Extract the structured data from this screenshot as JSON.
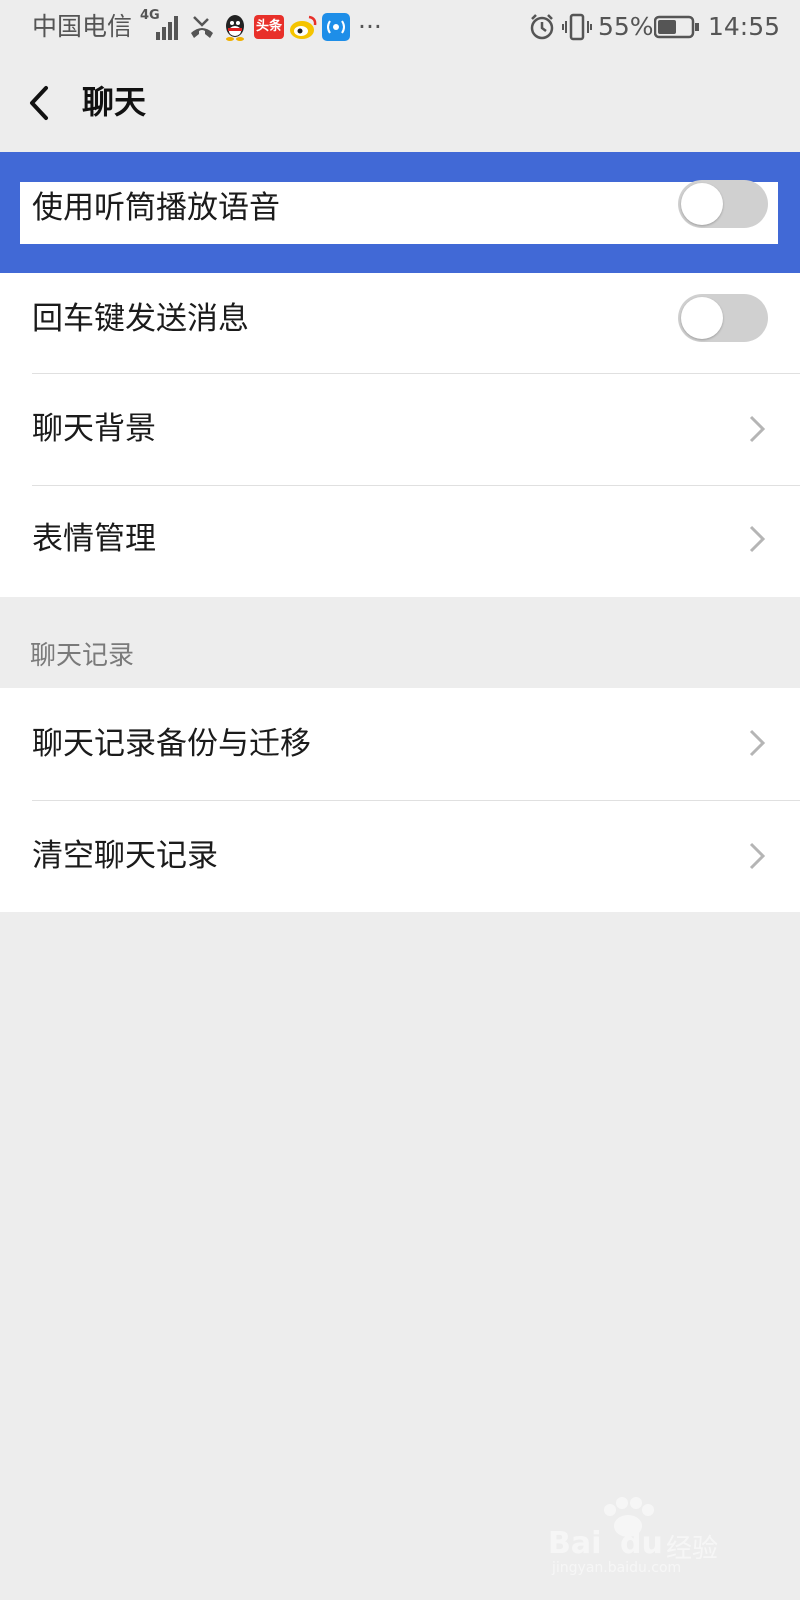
{
  "status_bar": {
    "carrier": "中国电信",
    "network": "4G",
    "battery": "55%",
    "time": "14:55",
    "more": "···",
    "toutiao_label": "头条"
  },
  "nav": {
    "title": "聊天"
  },
  "settings": {
    "general": [
      {
        "label": "使用听筒播放语音",
        "type": "toggle",
        "on": false
      },
      {
        "label": "回车键发送消息",
        "type": "toggle",
        "on": false
      },
      {
        "label": "聊天背景",
        "type": "link"
      },
      {
        "label": "表情管理",
        "type": "link"
      }
    ],
    "history_header": "聊天记录",
    "history": [
      {
        "label": "聊天记录备份与迁移",
        "type": "link"
      },
      {
        "label": "清空聊天记录",
        "type": "link"
      }
    ]
  },
  "colors": {
    "highlight": "#4169d6",
    "toggle_off": "#d0d0d0",
    "background": "#ededed"
  },
  "watermark": {
    "brand": "Bai",
    "brand2": "du",
    "brand_cn": "经验",
    "url": "jingyan.baidu.com"
  }
}
